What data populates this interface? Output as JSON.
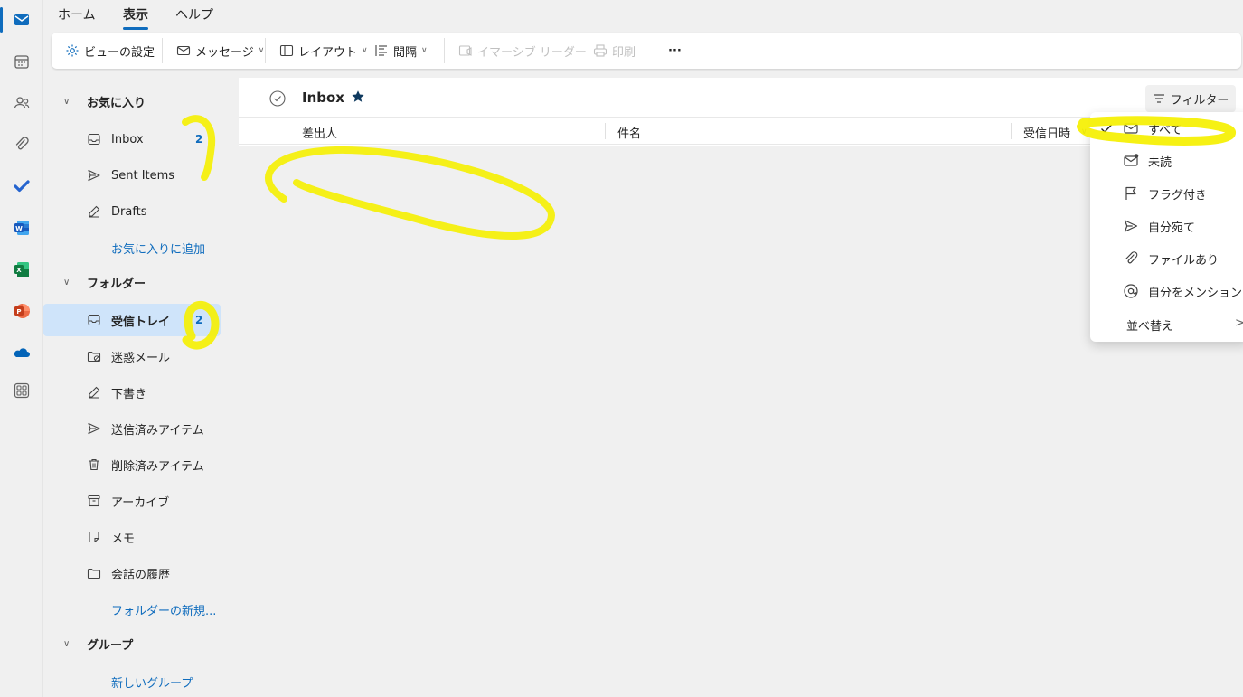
{
  "ribbon_tabs": [
    "ホーム",
    "表示",
    "ヘルプ"
  ],
  "ribbon": {
    "view_settings": "ビューの設定",
    "message": "メッセージ",
    "layout": "レイアウト",
    "spacing": "間隔",
    "immersive_reader": "イマーシブ リーダー",
    "print": "印刷",
    "more": "···"
  },
  "nav": {
    "favorites_header": "お気に入り",
    "favorites": [
      {
        "label": "Inbox",
        "icon": "inbox-icon",
        "count": "2"
      },
      {
        "label": "Sent Items",
        "icon": "send-icon",
        "count": ""
      },
      {
        "label": "Drafts",
        "icon": "pencil-icon",
        "count": ""
      }
    ],
    "add_favorite": "お気に入りに追加",
    "folders_header": "フォルダー",
    "folders": [
      {
        "label": "受信トレイ",
        "icon": "inbox-icon",
        "count": "2",
        "selected": true
      },
      {
        "label": "迷惑メール",
        "icon": "junk-folder-icon",
        "count": ""
      },
      {
        "label": "下書き",
        "icon": "pencil-icon",
        "count": ""
      },
      {
        "label": "送信済みアイテム",
        "icon": "send-icon",
        "count": ""
      },
      {
        "label": "削除済みアイテム",
        "icon": "trash-icon",
        "count": ""
      },
      {
        "label": "アーカイブ",
        "icon": "archive-icon",
        "count": ""
      },
      {
        "label": "メモ",
        "icon": "note-icon",
        "count": ""
      },
      {
        "label": "会話の履歴",
        "icon": "folder-icon",
        "count": ""
      }
    ],
    "new_folder": "フォルダーの新規...",
    "groups_header": "グループ",
    "new_group": "新しいグループ"
  },
  "main": {
    "title": "Inbox",
    "filter_label": "フィルター",
    "columns": [
      "差出人",
      "件名",
      "受信日時"
    ]
  },
  "filter_menu": {
    "items": [
      {
        "label": "すべて",
        "icon": "mail-icon",
        "checked": true
      },
      {
        "label": "未読",
        "icon": "unread-mail-icon",
        "checked": false
      },
      {
        "label": "フラグ付き",
        "icon": "flag-icon",
        "checked": false
      },
      {
        "label": "自分宛て",
        "icon": "send-icon",
        "checked": false
      },
      {
        "label": "ファイルあり",
        "icon": "paperclip-icon",
        "checked": false
      },
      {
        "label": "自分をメンション",
        "icon": "mention-icon",
        "checked": false
      }
    ],
    "sort_label": "並べ替え"
  },
  "colors": {
    "accent": "#0f6cbd",
    "selected_bg": "#cfe4fa",
    "highlighter": "#f5f000"
  }
}
